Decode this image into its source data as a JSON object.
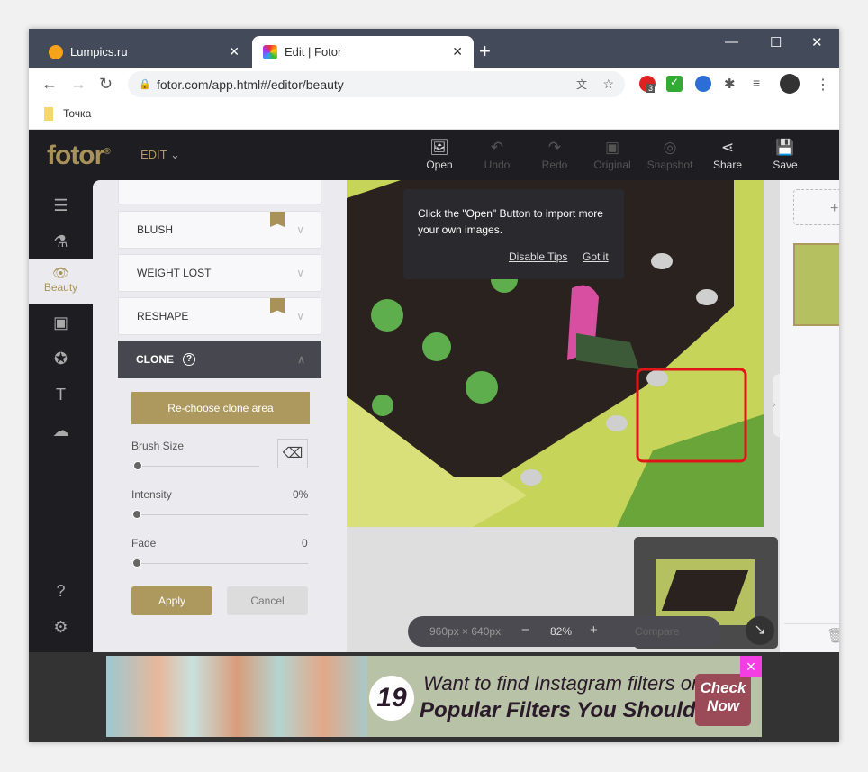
{
  "browser": {
    "tabs": [
      {
        "label": "Lumpics.ru",
        "active": false
      },
      {
        "label": "Edit | Fotor",
        "active": true
      }
    ],
    "url": "fotor.com/app.html#/editor/beauty",
    "bookmark": "Точка",
    "ext_badge": "3"
  },
  "header": {
    "logo": "fotor",
    "mode": "EDIT",
    "tools": [
      {
        "label": "Open",
        "enabled": true
      },
      {
        "label": "Undo",
        "enabled": false
      },
      {
        "label": "Redo",
        "enabled": false
      },
      {
        "label": "Original",
        "enabled": false
      },
      {
        "label": "Snapshot",
        "enabled": false
      },
      {
        "label": "Share",
        "enabled": true
      },
      {
        "label": "Save",
        "enabled": true
      }
    ]
  },
  "rail": {
    "active_label": "Beauty"
  },
  "panel": {
    "sections": [
      {
        "label": "BLUSH",
        "premium": true
      },
      {
        "label": "WEIGHT LOST",
        "premium": false
      },
      {
        "label": "RESHAPE",
        "premium": true
      }
    ],
    "clone": {
      "title": "CLONE",
      "rechoose": "Re-choose clone area",
      "brush_label": "Brush Size",
      "brush_value": 0,
      "intensity_label": "Intensity",
      "intensity_value": "0%",
      "fade_label": "Fade",
      "fade_value": "0",
      "apply": "Apply",
      "cancel": "Cancel"
    }
  },
  "tip": {
    "text": "Click the \"Open\" Button to import more your own images.",
    "disable": "Disable Tips",
    "got_it": "Got it"
  },
  "zoom": {
    "dimensions": "960px × 640px",
    "minus": "−",
    "level": "82%",
    "plus": "+",
    "compare": "Compare"
  },
  "ad": {
    "number": "19",
    "line1": "Want to find Instagram filters online?",
    "line2": "Popular Filters You Should Try",
    "cta": "Check Now",
    "close": "×"
  },
  "colors": {
    "accent": "#ad985e",
    "highlight": "#e0151a"
  }
}
